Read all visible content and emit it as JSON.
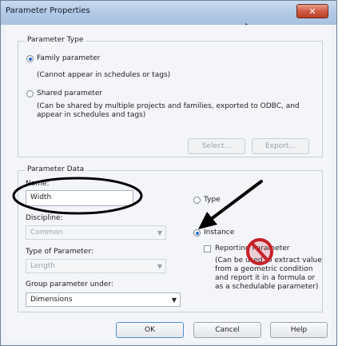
{
  "window": {
    "title": "Parameter Properties",
    "close_glyph": "✕"
  },
  "parameter_type": {
    "group_label": "Parameter Type",
    "family_label": "Family parameter",
    "family_note": "(Cannot appear in schedules or tags)",
    "shared_label": "Shared parameter",
    "shared_note": "(Can be shared by multiple projects and families, exported to ODBC, and appear in schedules and tags)",
    "select_button": "Select...",
    "export_button": "Export...",
    "selected": "family"
  },
  "parameter_data": {
    "group_label": "Parameter Data",
    "name_label": "Name:",
    "name_value": "Width",
    "discipline_label": "Discipline:",
    "discipline_value": "Common",
    "type_of_parameter_label": "Type of Parameter:",
    "type_of_parameter_value": "Length",
    "group_under_label": "Group parameter under:",
    "group_under_value": "Dimensions",
    "type_option": "Type",
    "instance_option": "Instance",
    "selected": "instance",
    "reporting_label": "Reporting Parameter",
    "reporting_checked": false,
    "reporting_note": "(Can be used to extract value from a geometric condition and report it in a formula or as a schedulable parameter)"
  },
  "buttons": {
    "ok": "OK",
    "cancel": "Cancel",
    "help": "Help"
  },
  "icons": [
    "close-icon",
    "cursor-icon",
    "dropdown-arrow-icon",
    "annotation-arrow-icon",
    "prohibited-icon"
  ],
  "colors": {
    "annotation": "#000000",
    "prohibited_sign": "#c8202a",
    "radio_fill": "#2a6ccf"
  }
}
